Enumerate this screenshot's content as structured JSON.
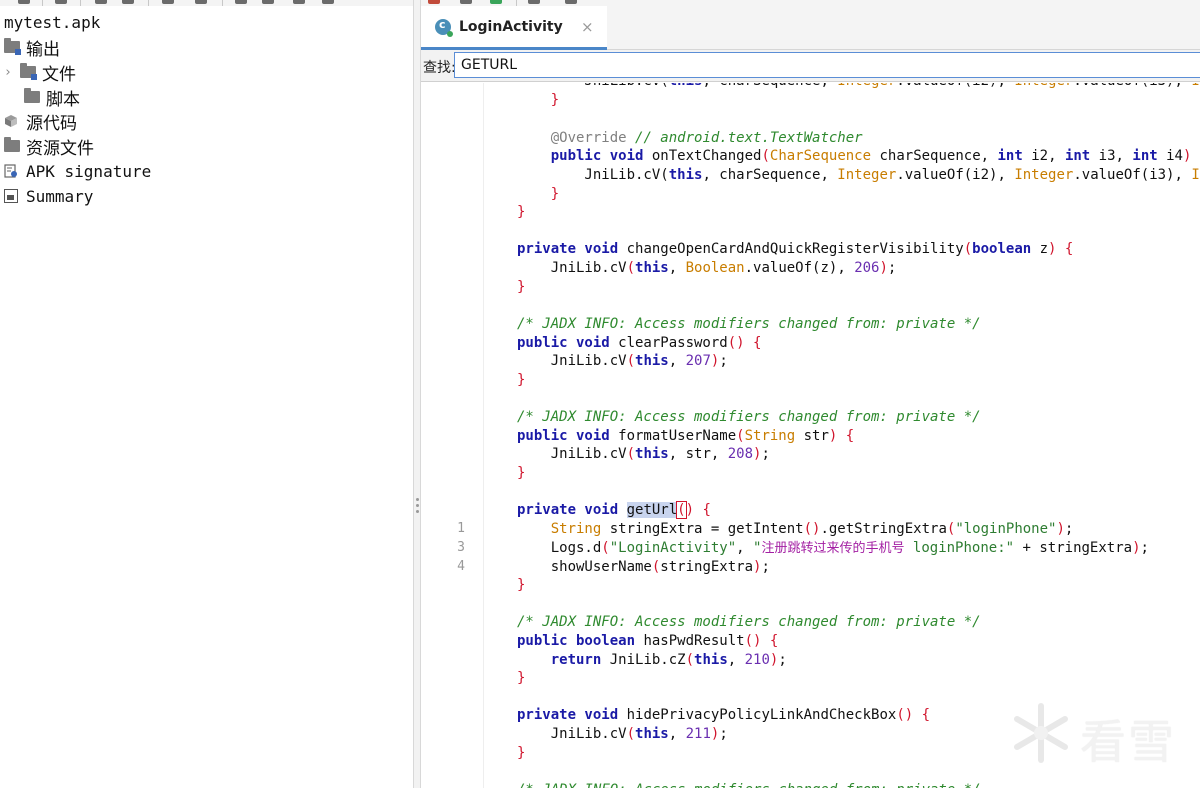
{
  "tree": {
    "root": "mytest.apk",
    "items": [
      {
        "label": "输出",
        "icon": "folder-icon"
      },
      {
        "label": "文件",
        "icon": "folder-icon"
      },
      {
        "label": "脚本",
        "icon": "folder-icon"
      },
      {
        "label": "源代码",
        "icon": "package-icon"
      },
      {
        "label": "资源文件",
        "icon": "folder-icon"
      },
      {
        "label": "APK signature",
        "icon": "certificate-icon"
      },
      {
        "label": "Summary",
        "icon": "summary-icon"
      }
    ]
  },
  "tab": {
    "title": "LoginActivity",
    "close": "×"
  },
  "search": {
    "label": "查找:",
    "value": "GETURL"
  },
  "line_numbers": [
    "1",
    "3",
    "4"
  ],
  "watermark": "看雪",
  "colors": {
    "accent": "#4a86c8",
    "keyword": "#1a1aa6",
    "type": "#c87d00",
    "comment": "#2f8a2f",
    "string": "#2e7d32",
    "number": "#6a2fb0",
    "brace": "#d0142c"
  }
}
